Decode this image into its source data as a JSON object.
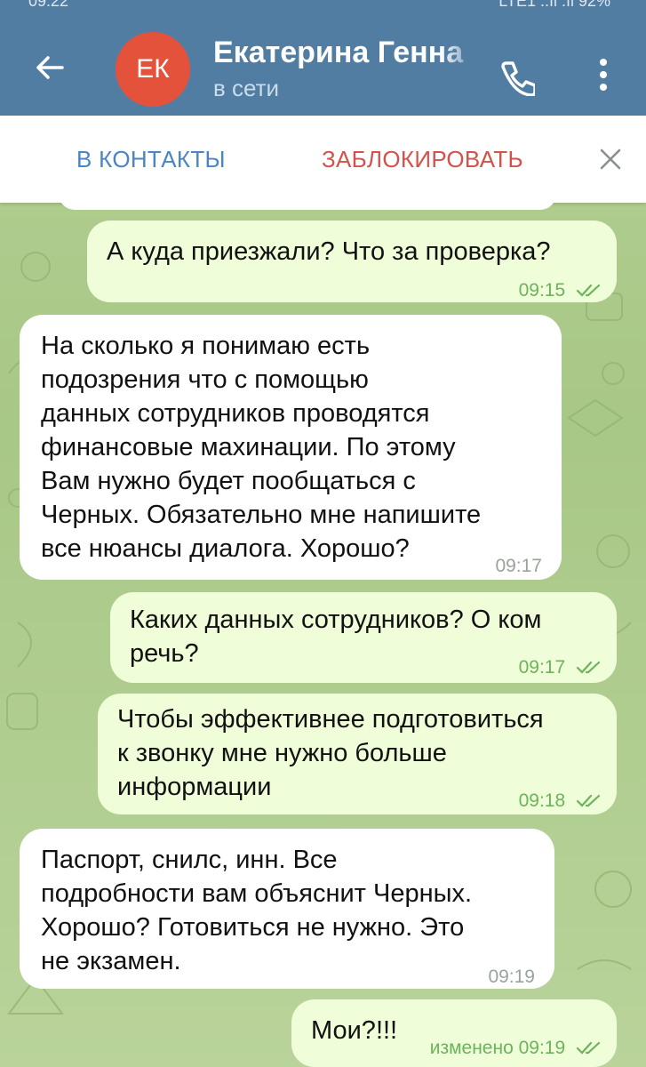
{
  "status_bar": {
    "time": "09:22",
    "signal": "LTE1 ..ıl .ıl 92%"
  },
  "header": {
    "avatar_initials": "ЕК",
    "contact_name": "Екатерина Генна",
    "contact_status": "в сети"
  },
  "action_bar": {
    "add_contact": "В КОНТАКТЫ",
    "block": "ЗАБЛОКИРОВАТЬ"
  },
  "messages": [
    {
      "direction": "out",
      "text": "А куда приезжали? Что за проверка?",
      "time": "09:15",
      "read": true
    },
    {
      "direction": "in",
      "text": "На сколько я понимаю есть\nподозрения что с помощью\nданных сотрудников проводятся\nфинансовые махинации. По этому\nВам нужно будет пообщаться с\nЧерных. Обязательно мне напишите\nвсе нюансы диалога. Хорошо?",
      "time": "09:17"
    },
    {
      "direction": "out",
      "text": "Каких данных сотрудников? О ком\nречь?",
      "time": "09:17",
      "read": true
    },
    {
      "direction": "out",
      "text": "Чтобы эффективнее подготовиться\nк звонку мне нужно больше\nинформации",
      "time": "09:18",
      "read": true
    },
    {
      "direction": "in",
      "text": "Паспорт, снилс, инн. Все\nподробности вам объяснит Черных.\nХорошо? Готовиться не нужно. Это\nне экзамен.",
      "time": "09:19"
    },
    {
      "direction": "out",
      "text": "Мои?!!!",
      "time": "изменено 09:19",
      "read": true
    }
  ],
  "colors": {
    "header": "#527da3",
    "avatar": "#e4523b",
    "add_contact": "#4a86c4",
    "block": "#d3524b",
    "outgoing_bubble": "#effed9",
    "incoming_bubble": "#ffffff",
    "read_check": "#6cb35b"
  }
}
